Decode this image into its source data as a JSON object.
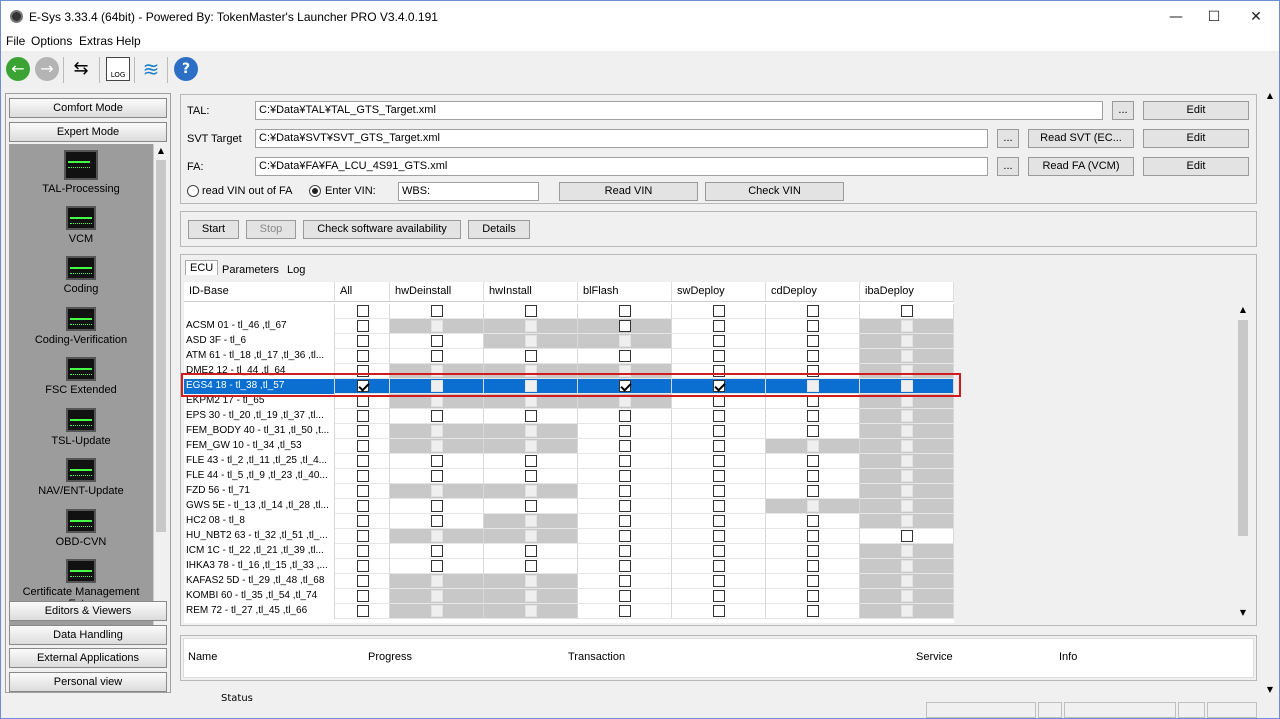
{
  "window": {
    "title": "E-Sys 3.33.4  (64bit) - Powered By: TokenMaster's Launcher PRO V3.4.0.191",
    "minimize": "—",
    "maximize": "☐",
    "close": "✕"
  },
  "menu": [
    "File",
    "Options",
    "Extras",
    "Help"
  ],
  "left_panel": {
    "mode_buttons": [
      "Comfort Mode",
      "Expert Mode"
    ],
    "plugins": [
      "TAL-Processing",
      "VCM",
      "Coding",
      "Coding-Verification",
      "FSC Extended",
      "TSL-Update",
      "NAV/ENT-Update",
      "OBD-CVN",
      "Certificate Management Ext..."
    ],
    "bottom_buttons": [
      "Editors & Viewers",
      "Data Handling",
      "External Applications",
      "Personal view"
    ]
  },
  "files": {
    "tal_label": "TAL:",
    "tal_path": "C:¥Data¥TAL¥TAL_GTS_Target.xml",
    "svt_label": "SVT Target",
    "svt_path": "C:¥Data¥SVT¥SVT_GTS_Target.xml",
    "fa_label": "FA:",
    "fa_path": "C:¥Data¥FA¥FA_LCU_4S91_GTS.xml",
    "browse": "...",
    "edit": "Edit",
    "read_svt": "Read SVT (EC...",
    "read_fa": "Read FA (VCM)"
  },
  "vin": {
    "opt_fa": "read VIN out of FA",
    "opt_enter": "Enter VIN:",
    "value": "WBS:",
    "read_vin": "Read VIN",
    "check_vin": "Check VIN"
  },
  "actions": {
    "start": "Start",
    "stop": "Stop",
    "check": "Check software availability",
    "details": "Details"
  },
  "tabs": [
    "ECU",
    "Parameters",
    "Log"
  ],
  "grid": {
    "columns": [
      "ID-Base",
      "All",
      "hwDeinstall",
      "hwInstall",
      "blFlash",
      "swDeploy",
      "cdDeploy",
      "ibaDeploy"
    ],
    "rows": [
      {
        "id": "",
        "cells": [
          1,
          1,
          1,
          1,
          1,
          1,
          1
        ],
        "gray": [
          0,
          0,
          0,
          0,
          0,
          0,
          0
        ]
      },
      {
        "id": "ACSM 01 - tl_46 ,tl_67",
        "cells": [
          1,
          0,
          0,
          1,
          1,
          1,
          0
        ],
        "gray": [
          0,
          1,
          1,
          1,
          0,
          0,
          1
        ]
      },
      {
        "id": "ASD 3F - tl_6",
        "cells": [
          1,
          1,
          0,
          0,
          1,
          1,
          0
        ],
        "gray": [
          0,
          0,
          1,
          1,
          0,
          0,
          1
        ]
      },
      {
        "id": "ATM 61 - tl_18 ,tl_17 ,tl_36 ,tl...",
        "cells": [
          1,
          1,
          1,
          1,
          1,
          1,
          0
        ],
        "gray": [
          0,
          0,
          0,
          0,
          0,
          0,
          1
        ]
      },
      {
        "id": "DME2 12 - tl_44 ,tl_64",
        "cells": [
          1,
          0,
          0,
          0,
          1,
          1,
          0
        ],
        "gray": [
          0,
          1,
          1,
          1,
          0,
          0,
          1
        ]
      },
      {
        "id": "EGS4 18 - tl_38 ,tl_57",
        "cells": [
          2,
          0,
          0,
          2,
          2,
          0,
          0
        ],
        "gray": [
          3,
          3,
          3,
          3,
          3,
          3,
          3
        ],
        "selected": true
      },
      {
        "id": "EKPM2 17 - tl_65",
        "cells": [
          1,
          0,
          0,
          0,
          1,
          1,
          0
        ],
        "gray": [
          0,
          1,
          1,
          1,
          0,
          0,
          1
        ]
      },
      {
        "id": "EPS 30 - tl_20 ,tl_19 ,tl_37 ,tl...",
        "cells": [
          1,
          1,
          1,
          1,
          1,
          1,
          0
        ],
        "gray": [
          0,
          0,
          0,
          0,
          0,
          0,
          1
        ]
      },
      {
        "id": "FEM_BODY 40 - tl_31 ,tl_50 ,t...",
        "cells": [
          1,
          0,
          0,
          1,
          1,
          1,
          0
        ],
        "gray": [
          0,
          1,
          1,
          0,
          0,
          0,
          1
        ]
      },
      {
        "id": "FEM_GW 10 - tl_34 ,tl_53",
        "cells": [
          1,
          0,
          0,
          1,
          1,
          0,
          0
        ],
        "gray": [
          0,
          1,
          1,
          0,
          0,
          1,
          1
        ]
      },
      {
        "id": "FLE 43 - tl_2 ,tl_11 ,tl_25 ,tl_4...",
        "cells": [
          1,
          1,
          1,
          1,
          1,
          1,
          0
        ],
        "gray": [
          0,
          0,
          0,
          0,
          0,
          0,
          1
        ]
      },
      {
        "id": "FLE 44 - tl_5 ,tl_9 ,tl_23 ,tl_40...",
        "cells": [
          1,
          1,
          1,
          1,
          1,
          1,
          0
        ],
        "gray": [
          0,
          0,
          0,
          0,
          0,
          0,
          1
        ]
      },
      {
        "id": "FZD 56 - tl_71",
        "cells": [
          1,
          0,
          0,
          1,
          1,
          1,
          0
        ],
        "gray": [
          0,
          1,
          1,
          0,
          0,
          0,
          1
        ]
      },
      {
        "id": "GWS 5E - tl_13 ,tl_14 ,tl_28 ,tl...",
        "cells": [
          1,
          1,
          1,
          1,
          1,
          0,
          0
        ],
        "gray": [
          0,
          0,
          0,
          0,
          0,
          1,
          1
        ]
      },
      {
        "id": "HC2 08 - tl_8",
        "cells": [
          1,
          1,
          0,
          1,
          1,
          1,
          0
        ],
        "gray": [
          0,
          0,
          1,
          0,
          0,
          0,
          1
        ]
      },
      {
        "id": "HU_NBT2 63 - tl_32 ,tl_51 ,tl_...",
        "cells": [
          1,
          0,
          0,
          1,
          1,
          1,
          1
        ],
        "gray": [
          0,
          1,
          1,
          0,
          0,
          0,
          0
        ]
      },
      {
        "id": "ICM 1C - tl_22 ,tl_21 ,tl_39 ,tl...",
        "cells": [
          1,
          1,
          1,
          1,
          1,
          1,
          0
        ],
        "gray": [
          0,
          0,
          0,
          0,
          0,
          0,
          1
        ]
      },
      {
        "id": "IHKA3 78 - tl_16 ,tl_15 ,tl_33 ,...",
        "cells": [
          1,
          1,
          1,
          1,
          1,
          1,
          0
        ],
        "gray": [
          0,
          0,
          0,
          0,
          0,
          0,
          1
        ]
      },
      {
        "id": "KAFAS2 5D - tl_29 ,tl_48 ,tl_68",
        "cells": [
          1,
          0,
          0,
          1,
          1,
          1,
          0
        ],
        "gray": [
          0,
          1,
          1,
          0,
          0,
          0,
          1
        ]
      },
      {
        "id": "KOMBI 60 - tl_35 ,tl_54 ,tl_74",
        "cells": [
          1,
          0,
          0,
          1,
          1,
          1,
          0
        ],
        "gray": [
          0,
          1,
          1,
          0,
          0,
          0,
          1
        ]
      },
      {
        "id": "REM 72 - tl_27 ,tl_45 ,tl_66",
        "cells": [
          1,
          0,
          0,
          1,
          1,
          1,
          0
        ],
        "gray": [
          0,
          1,
          1,
          0,
          0,
          0,
          1
        ]
      }
    ]
  },
  "bottom_columns": [
    "Name",
    "Progress",
    "Transaction",
    "Service",
    "Info"
  ],
  "status_label": "Status"
}
